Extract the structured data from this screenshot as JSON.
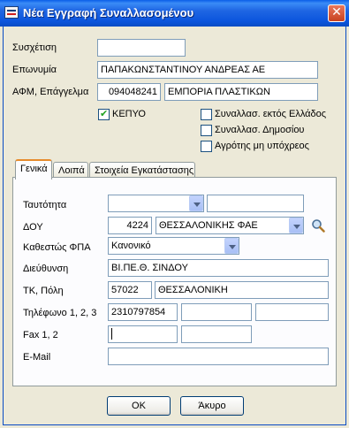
{
  "window": {
    "title": "Νέα Εγγραφή Συναλλασομένου",
    "close_symbol": "✕"
  },
  "form": {
    "syschetisi": {
      "label": "Συσχέτιση",
      "value": ""
    },
    "eponymia": {
      "label": "Επωνυμία",
      "value": "ΠΑΠΑΚΩΝΣΤΑΝΤΙΝΟΥ ΑΝΔΡΕΑΣ ΑΕ"
    },
    "afm": {
      "label": "ΑΦΜ, Επάγγελμα",
      "afm_value": "094048241",
      "profession_value": "ΕΜΠΟΡΙΑ ΠΛΑΣΤΙΚΩΝ"
    },
    "checkboxes": {
      "kepyo": {
        "label": "ΚΕΠΥΟ",
        "checked": true
      },
      "abroad": {
        "label": "Συναλλασ. εκτός Ελλάδος",
        "checked": false
      },
      "public": {
        "label": "Συναλλασ. Δημοσίου",
        "checked": false
      },
      "farmer": {
        "label": "Αγρότης μη υπόχρεος",
        "checked": false
      }
    }
  },
  "tabs": [
    {
      "label": "Γενικά",
      "active": true
    },
    {
      "label": "Λοιπά",
      "active": false
    },
    {
      "label": "Στοιχεία Εγκατάστασης",
      "active": false
    }
  ],
  "general": {
    "identity": {
      "label": "Ταυτότητα",
      "type_value": "",
      "number_value": ""
    },
    "doy": {
      "label": "ΔΟΥ",
      "code": "4224",
      "name": "ΘΕΣΣΑΛΟΝΙΚΗΣ ΦΑΕ",
      "icon": "search-icon"
    },
    "vat": {
      "label": "Καθεστώς ΦΠΑ",
      "value": "Κανονικό"
    },
    "address": {
      "label": "Διεύθυνση",
      "value": "ΒΙ.ΠΕ.Θ. ΣΙΝΔΟΥ"
    },
    "tk_city": {
      "label": "ΤΚ, Πόλη",
      "tk": "57022",
      "city": "ΘΕΣΣΑΛΟΝΙΚΗ"
    },
    "phones": {
      "label": "Τηλέφωνο 1, 2, 3",
      "phone1": "2310797854",
      "phone2": "",
      "phone3": ""
    },
    "fax": {
      "label": "Fax 1, 2",
      "fax1": "",
      "fax2": ""
    },
    "email": {
      "label": "E-Mail",
      "value": ""
    }
  },
  "buttons": {
    "ok": "OK",
    "cancel": "Άκυρο"
  }
}
